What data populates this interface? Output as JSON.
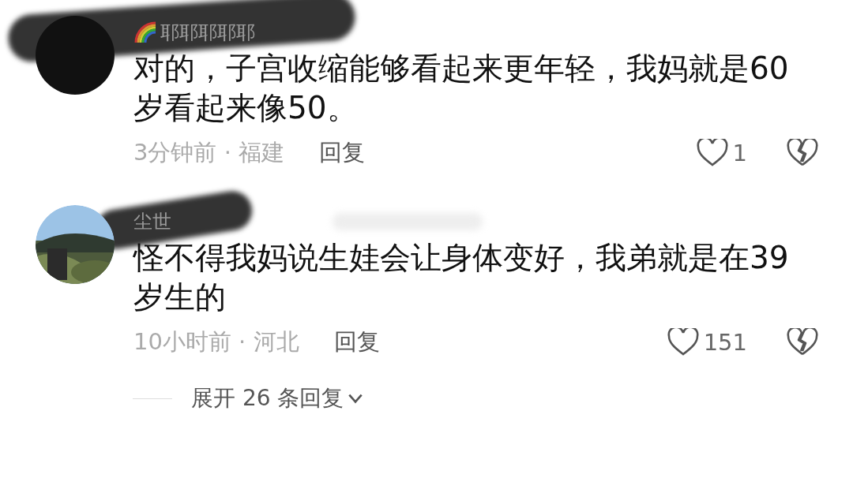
{
  "comments": [
    {
      "avatar": {
        "kind": "dark"
      },
      "username": "耶耶耶耶耶",
      "name_badge": true,
      "text": "对的，子宫收缩能够看起来更年轻，我妈就是60岁看起来像50。",
      "meta": "3分钟前 · 福建",
      "reply": "回复",
      "likes": "1"
    },
    {
      "username": "尘世",
      "name_badge": false,
      "text": "怪不得我妈说生娃会让身体变好，我弟就是在39岁生的",
      "meta": "10小时前 · 河北",
      "reply": "回复",
      "likes": "151"
    }
  ],
  "expand": {
    "label": "展开 26 条回复"
  }
}
